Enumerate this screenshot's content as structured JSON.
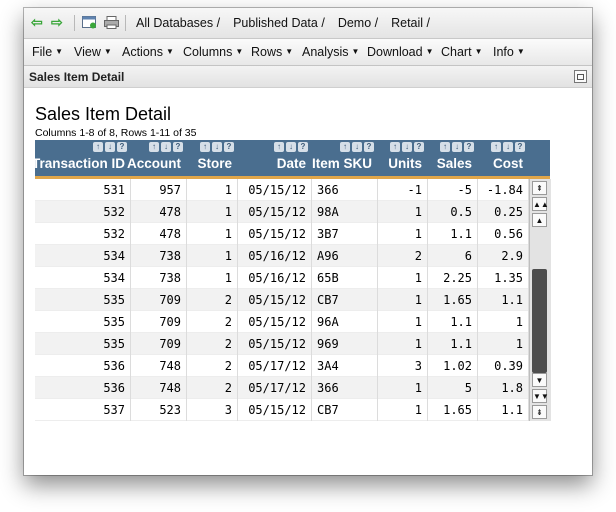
{
  "breadcrumbs": [
    "All Databases /",
    "Published Data /",
    "Demo /",
    "Retail /"
  ],
  "nav": {
    "back": "⇦",
    "forward": "⇨"
  },
  "menus": [
    "File",
    "View",
    "Actions",
    "Columns",
    "Rows",
    "Analysis",
    "Download",
    "Chart",
    "Info"
  ],
  "section_title": "Sales Item Detail",
  "report": {
    "title": "Sales Item Detail",
    "subtitle": "Columns 1-8 of 8,  Rows 1-11 of 35"
  },
  "table": {
    "header_icons": [
      "↑",
      "↓",
      "?"
    ],
    "columns": [
      "Transaction ID",
      "Account",
      "Store",
      "Date",
      "Item SKU",
      "Units",
      "Sales",
      "Cost"
    ],
    "rows": [
      [
        "531",
        "957",
        "1",
        "05/15/12",
        "366",
        "-1",
        "-5",
        "-1.84"
      ],
      [
        "532",
        "478",
        "1",
        "05/15/12",
        "98A",
        "1",
        "0.5",
        "0.25"
      ],
      [
        "532",
        "478",
        "1",
        "05/15/12",
        "3B7",
        "1",
        "1.1",
        "0.56"
      ],
      [
        "534",
        "738",
        "1",
        "05/16/12",
        "A96",
        "2",
        "6",
        "2.9"
      ],
      [
        "534",
        "738",
        "1",
        "05/16/12",
        "65B",
        "1",
        "2.25",
        "1.35"
      ],
      [
        "535",
        "709",
        "2",
        "05/15/12",
        "CB7",
        "1",
        "1.65",
        "1.1"
      ],
      [
        "535",
        "709",
        "2",
        "05/15/12",
        "96A",
        "1",
        "1.1",
        "1"
      ],
      [
        "535",
        "709",
        "2",
        "05/15/12",
        "969",
        "1",
        "1.1",
        "1"
      ],
      [
        "536",
        "748",
        "2",
        "05/17/12",
        "3A4",
        "3",
        "1.02",
        "0.39"
      ],
      [
        "536",
        "748",
        "2",
        "05/17/12",
        "366",
        "1",
        "5",
        "1.8"
      ],
      [
        "537",
        "523",
        "3",
        "05/15/12",
        "CB7",
        "1",
        "1.65",
        "1.1"
      ]
    ]
  },
  "scrollbar": {
    "top_icon": "⇞",
    "page_up_icon": "▲▲",
    "up_icon": "▲",
    "down_icon": "▼",
    "page_down_icon": "▼▼",
    "bottom_icon": "⇟"
  },
  "colors": {
    "header_bg": "#4a6e8f",
    "header_underline": "#e0a64a",
    "nav_arrows": "#3aa63a"
  }
}
